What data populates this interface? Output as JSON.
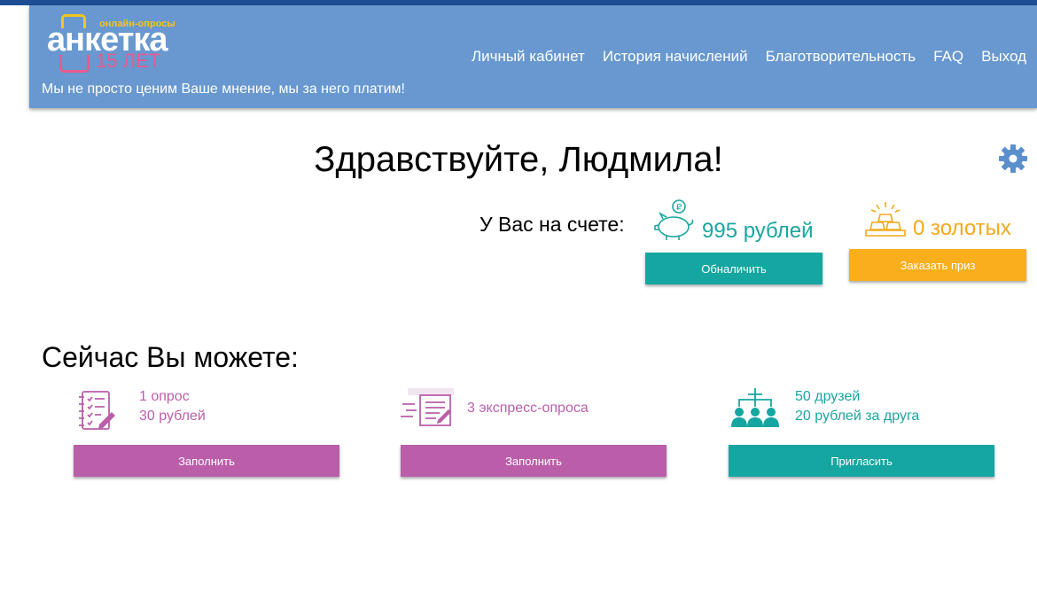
{
  "header": {
    "logo": {
      "tag": "онлайн-опросы",
      "brand": "анкетка",
      "years": "15 ЛЕТ"
    },
    "tagline": "Мы не просто ценим Ваше мнение, мы за него платим!",
    "nav": [
      {
        "label": "Личный кабинет"
      },
      {
        "label": "История начислений"
      },
      {
        "label": "Благотворительность"
      },
      {
        "label": "FAQ"
      },
      {
        "label": "Выход"
      }
    ]
  },
  "greeting": "Здравствуйте, Людмила!",
  "balance": {
    "label": "У Вас на счете:",
    "rubles": "995 рублей",
    "gold": "0 золотых",
    "withdraw_label": "Обналичить",
    "prize_label": "Заказать приз"
  },
  "actions": {
    "title": "Сейчас Вы можете:",
    "survey": {
      "line1": "1 опрос",
      "line2": "30 рублей",
      "button": "Заполнить"
    },
    "express": {
      "line1": "3 экспресс-опроса",
      "button": "Заполнить"
    },
    "invite": {
      "line1": "50 друзей",
      "line2": "20 рублей за друга",
      "button": "Пригласить"
    }
  },
  "colors": {
    "header_bg": "#6898cf",
    "teal": "#15a6a1",
    "orange": "#f9ae1b",
    "purple": "#bb5ea9"
  },
  "icons": [
    "gear-icon",
    "piggy-bank-icon",
    "gold-bars-icon",
    "checklist-icon",
    "express-survey-icon",
    "invite-friends-icon"
  ]
}
